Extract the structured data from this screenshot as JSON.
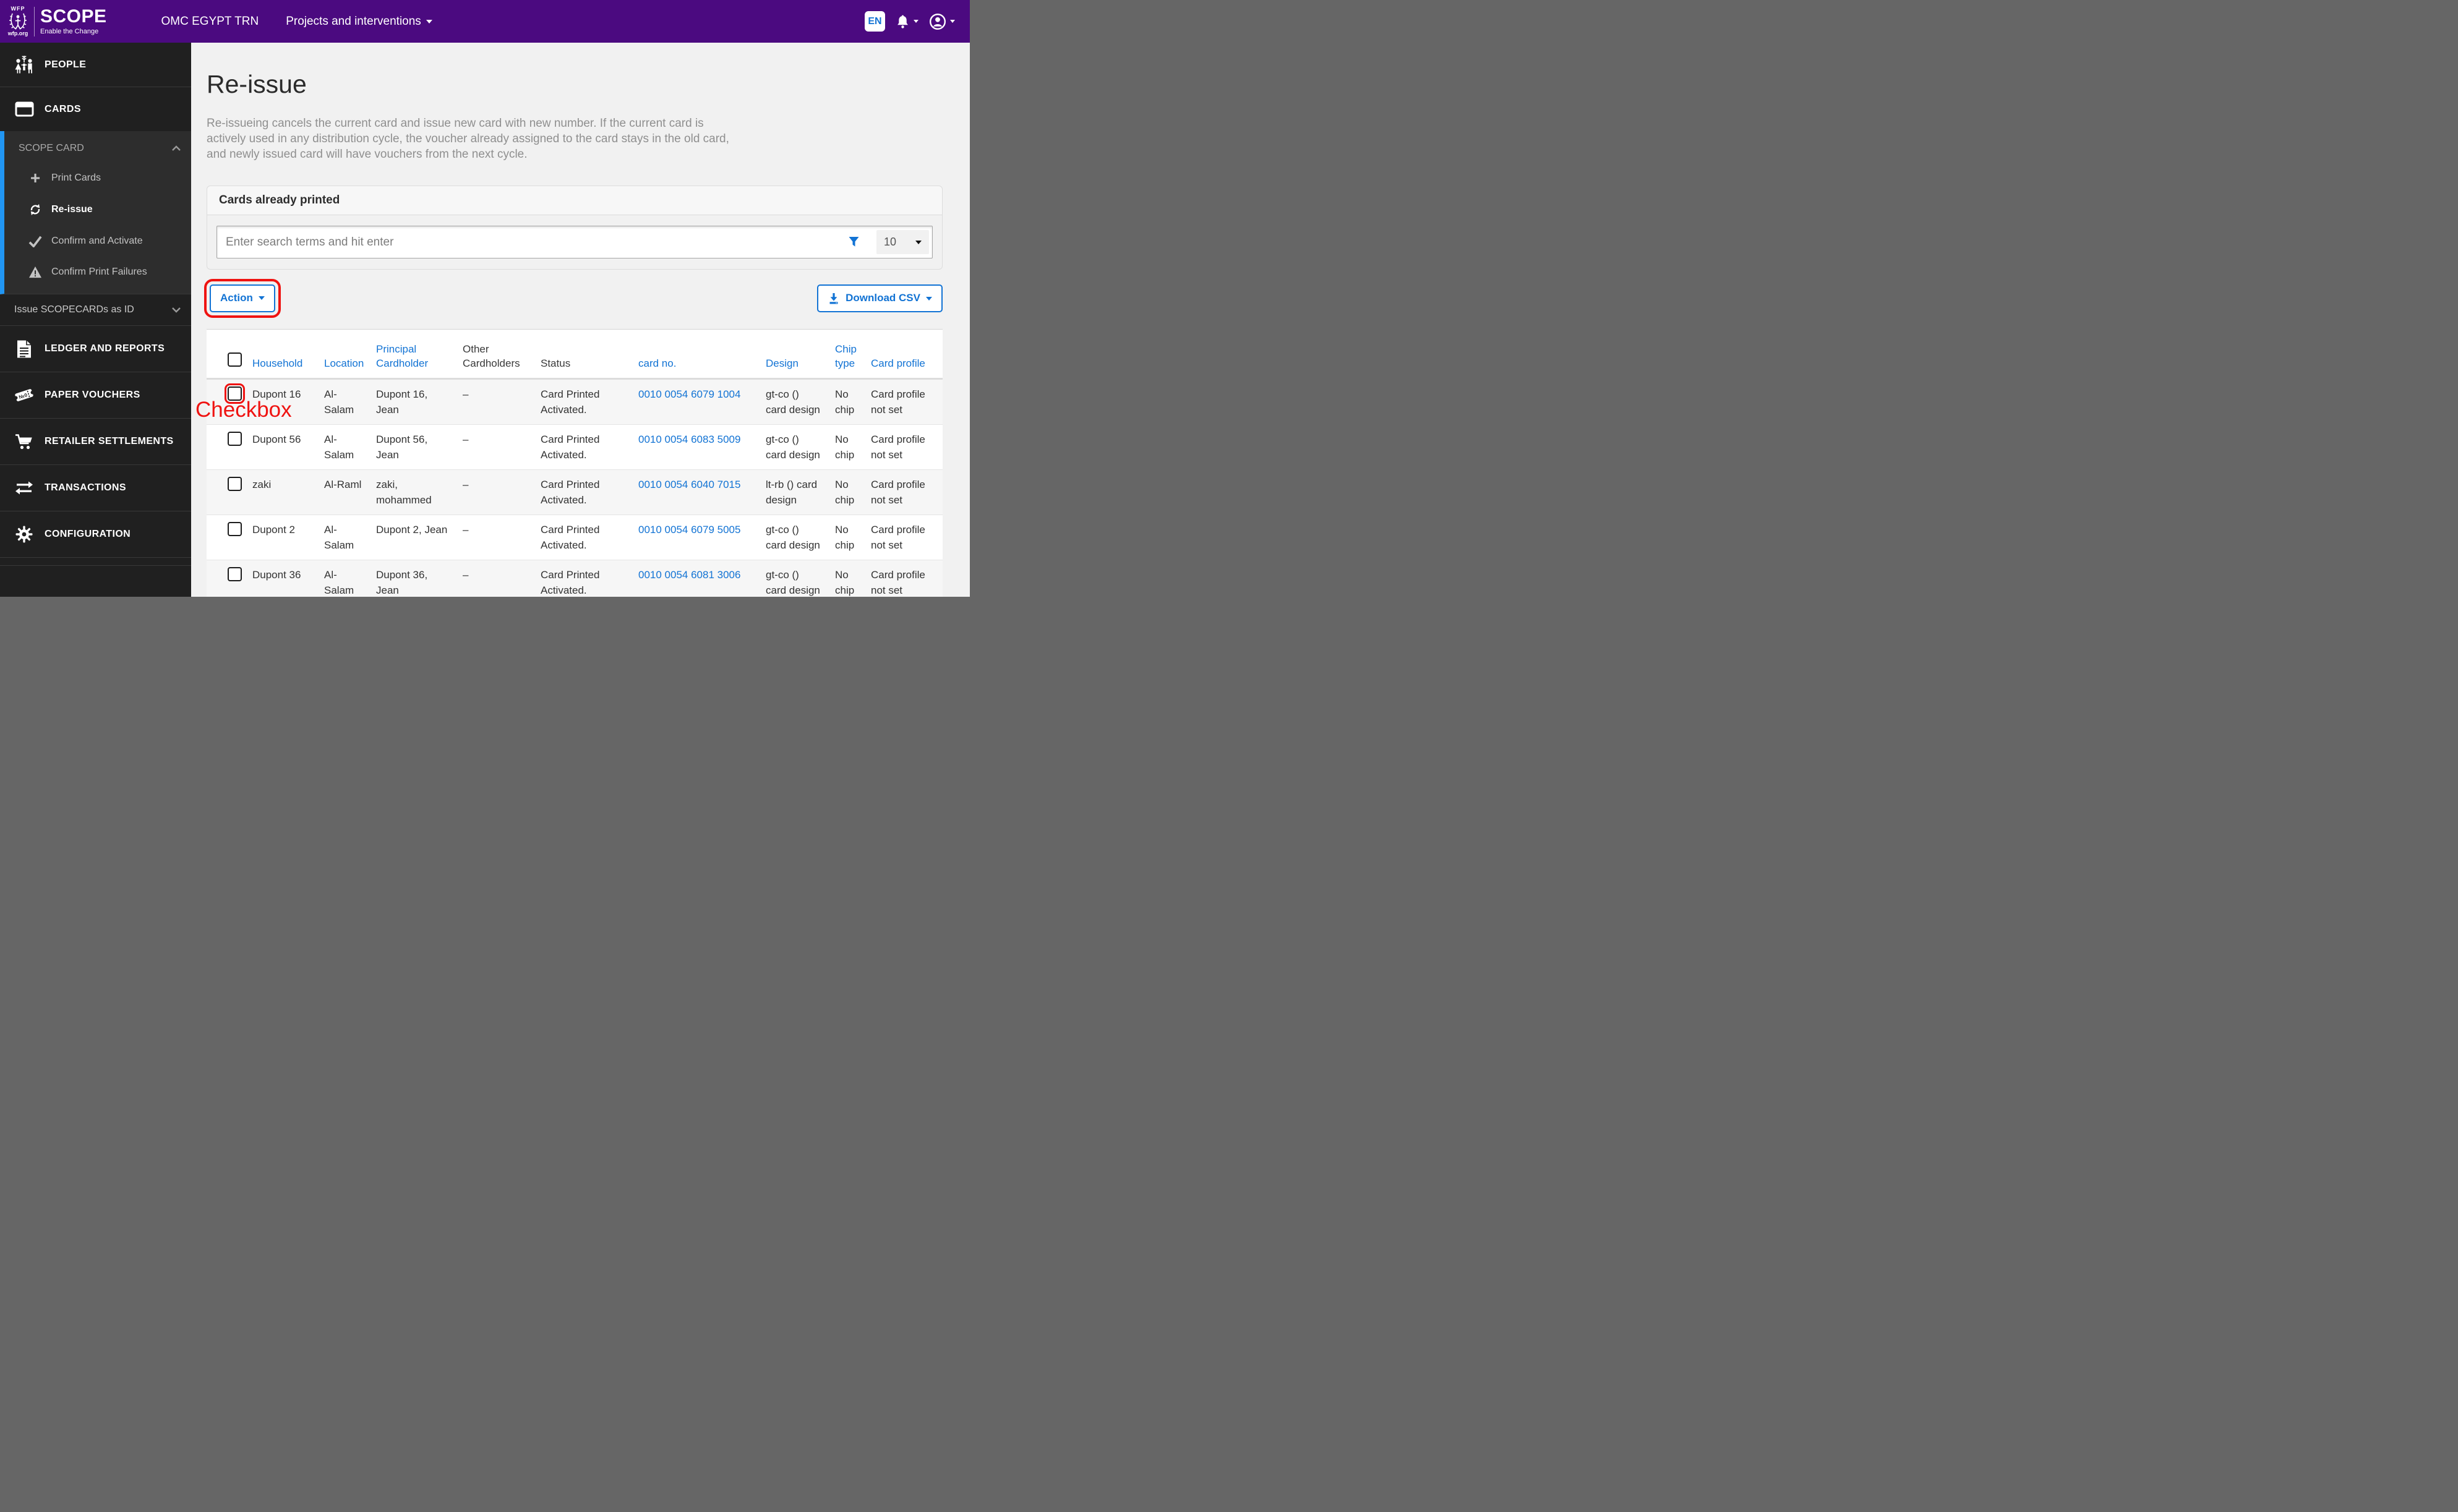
{
  "colors": {
    "brand_purple": "#4b0a80",
    "accent_blue": "#1273d4",
    "sidebar_active_blue": "#2196f3",
    "annotation_red": "#ef1311"
  },
  "header": {
    "org": "WFP",
    "brand": "SCOPE",
    "tagline": "Enable the Change",
    "site": "wfp.org",
    "country": "OMC EGYPT TRN",
    "projects_menu": "Projects and interventions",
    "language": "EN"
  },
  "sidebar": {
    "people": "PEOPLE",
    "cards": "CARDS",
    "scope_card": "SCOPE CARD",
    "scope_card_children": {
      "print": "Print Cards",
      "reissue": "Re-issue",
      "confirm": "Confirm and Activate",
      "failures": "Confirm Print Failures"
    },
    "issue_id": "Issue SCOPECARDs as ID",
    "ledger": "LEDGER AND REPORTS",
    "vouchers": "PAPER VOUCHERS",
    "retailer": "RETAILER SETTLEMENTS",
    "transactions": "TRANSACTIONS",
    "configuration": "CONFIGURATION"
  },
  "main": {
    "title": "Re-issue",
    "description": "Re-issueing cancels the current card and issue new card with new number. If the current card is\nactively used in any distribution cycle, the voucher already assigned to the card stays in the old card,\nand newly issued card will have vouchers from the next cycle.",
    "panel": {
      "title": "Cards already printed",
      "search_placeholder": "Enter search terms and hit enter",
      "page_size": "10",
      "action_label": "Action",
      "download_label": "Download CSV"
    },
    "table": {
      "columns": [
        {
          "label": "Household",
          "sortable": true
        },
        {
          "label": "Location",
          "sortable": true
        },
        {
          "label": "Principal\nCardholder",
          "sortable": true
        },
        {
          "label": "Other\nCardholders",
          "sortable": false
        },
        {
          "label": "Status",
          "sortable": false
        },
        {
          "label": "card no.",
          "sortable": true
        },
        {
          "label": "Design",
          "sortable": true
        },
        {
          "label": "Chip\ntype",
          "sortable": true
        },
        {
          "label": "Card profile",
          "sortable": true
        }
      ],
      "rows": [
        {
          "household": "Dupont 16",
          "location": "Al-\nSalam",
          "principal": "Dupont 16,\nJean",
          "others": "–",
          "status": "Card Printed\nActivated.",
          "card_no": "0010 0054 6079 1004",
          "design": "gt-co ()\ncard design",
          "chip_type": "No\nchip",
          "card_profile": "Card profile\nnot set"
        },
        {
          "household": "Dupont 56",
          "location": "Al-\nSalam",
          "principal": "Dupont 56,\nJean",
          "others": "–",
          "status": "Card Printed\nActivated.",
          "card_no": "0010 0054 6083 5009",
          "design": "gt-co ()\ncard design",
          "chip_type": "No\nchip",
          "card_profile": "Card profile\nnot set"
        },
        {
          "household": "zaki",
          "location": "Al-Raml",
          "principal": "zaki,\nmohammed",
          "others": "–",
          "status": "Card Printed\nActivated.",
          "card_no": "0010 0054 6040 7015",
          "design": "lt-rb () card\ndesign",
          "chip_type": "No\nchip",
          "card_profile": "Card profile\nnot set"
        },
        {
          "household": "Dupont 2",
          "location": "Al-\nSalam",
          "principal": "Dupont 2, Jean",
          "others": "–",
          "status": "Card Printed\nActivated.",
          "card_no": "0010 0054 6079 5005",
          "design": "gt-co ()\ncard design",
          "chip_type": "No\nchip",
          "card_profile": "Card profile\nnot set"
        },
        {
          "household": "Dupont 36",
          "location": "Al-\nSalam",
          "principal": "Dupont 36,\nJean",
          "others": "–",
          "status": "Card Printed\nActivated.",
          "card_no": "0010 0054 6081 3006",
          "design": "gt-co ()\ncard design",
          "chip_type": "No\nchip",
          "card_profile": "Card profile\nnot set"
        }
      ]
    }
  },
  "annotation": {
    "label": "Checkbox"
  }
}
